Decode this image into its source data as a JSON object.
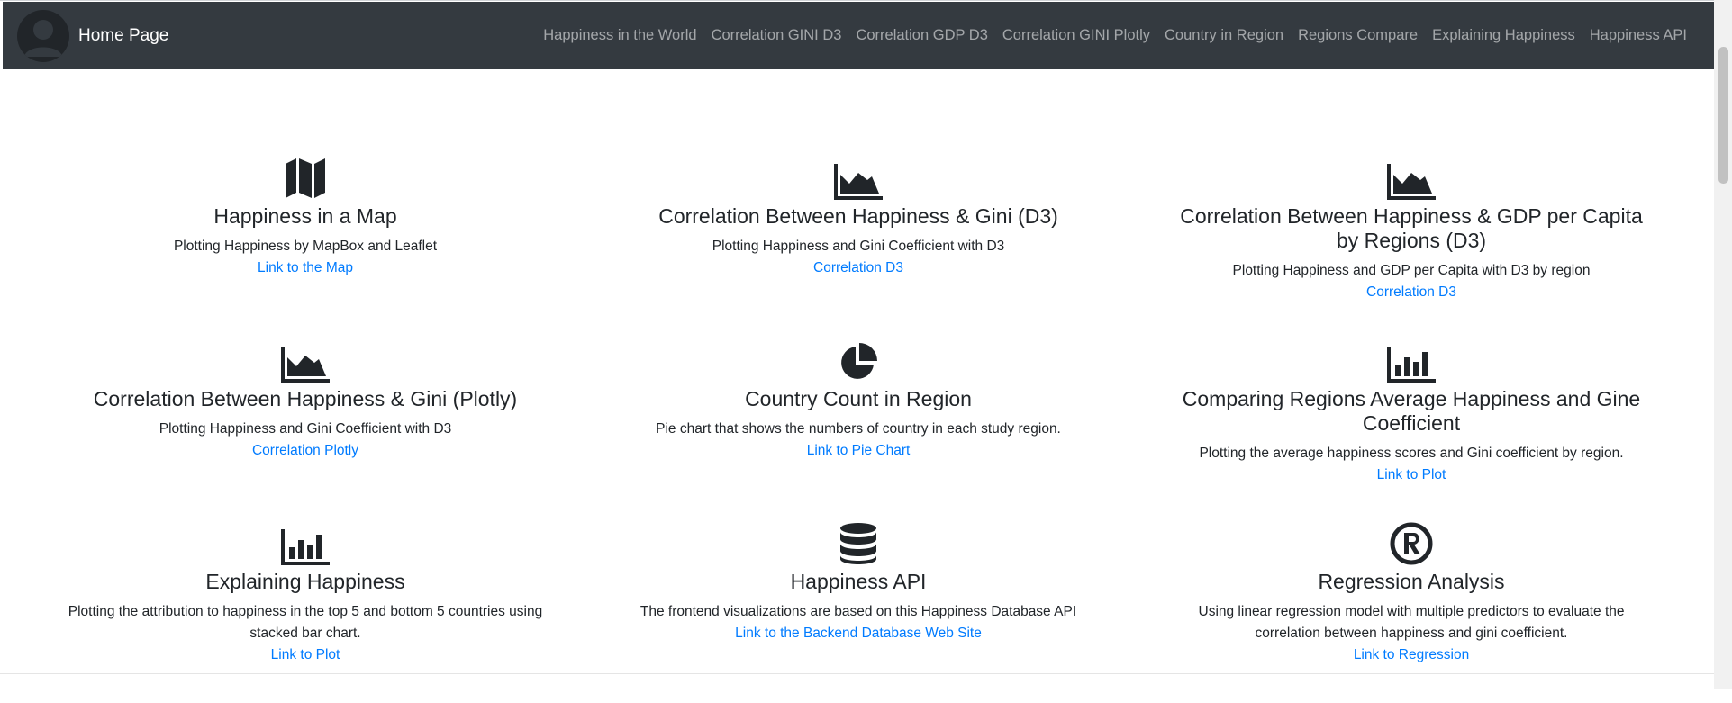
{
  "navbar": {
    "brand_label": "Home Page",
    "links": [
      "Happiness in the World",
      "Correlation GINI D3",
      "Correlation GDP D3",
      "Correlation GINI Plotly",
      "Country in Region",
      "Regions Compare",
      "Explaining Happiness",
      "Happiness API"
    ]
  },
  "cards": [
    {
      "icon": "map-icon",
      "title": "Happiness in a Map",
      "description": "Plotting Happiness by MapBox and Leaflet",
      "link": "Link to the Map"
    },
    {
      "icon": "area-chart-icon",
      "title": "Correlation Between Happiness & Gini (D3)",
      "description": "Plotting Happiness and Gini Coefficient with D3",
      "link": "Correlation D3"
    },
    {
      "icon": "area-chart-icon",
      "title": "Correlation Between Happiness & GDP per Capita by Regions (D3)",
      "description": "Plotting Happiness and GDP per Capita with D3 by region",
      "link": "Correlation D3"
    },
    {
      "icon": "area-chart-icon",
      "title": "Correlation Between Happiness & Gini (Plotly)",
      "description": "Plotting Happiness and Gini Coefficient with D3",
      "link": "Correlation Plotly"
    },
    {
      "icon": "pie-chart-icon",
      "title": "Country Count in Region",
      "description": "Pie chart that shows the numbers of country in each study region.",
      "link": "Link to Pie Chart"
    },
    {
      "icon": "bar-chart-icon",
      "title": "Comparing Regions Average Happiness and Gine Coefficient",
      "description": "Plotting the average happiness scores and Gini coefficient by region.",
      "link": "Link to Plot"
    },
    {
      "icon": "bar-chart-icon",
      "title": "Explaining Happiness",
      "description": "Plotting the attribution to happiness in the top 5 and bottom 5 countries using stacked bar chart.",
      "link": "Link to Plot"
    },
    {
      "icon": "database-icon",
      "title": "Happiness API",
      "description": "The frontend visualizations are based on this Happiness Database API",
      "link": "Link to the Backend Database Web Site"
    },
    {
      "icon": "registered-icon",
      "title": "Regression Analysis",
      "description": "Using linear regression model with multiple predictors to evaluate the correlation between happiness and gini coefficient.",
      "link": "Link to Regression"
    }
  ],
  "colors": {
    "navbar_bg": "#343a40",
    "link": "#007bff",
    "icon": "#212529"
  }
}
